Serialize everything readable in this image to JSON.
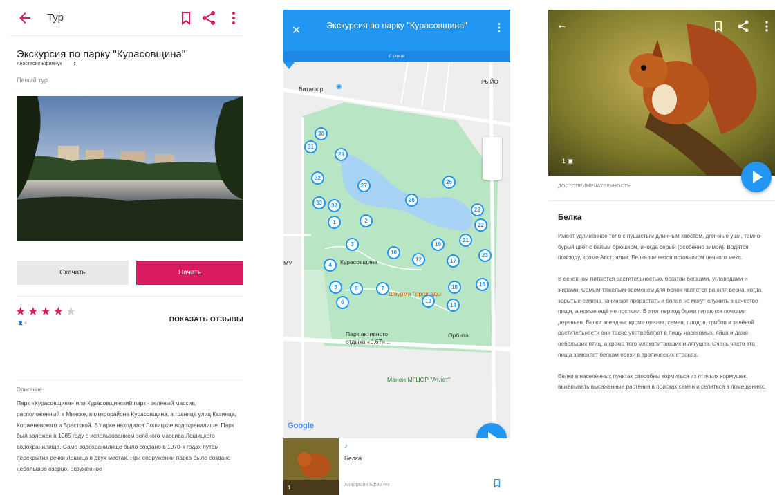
{
  "colors": {
    "accent_pink": "#d81b60",
    "accent_blue": "#2196f3",
    "water": "#a9d3f5",
    "park": "#b8e5c4"
  },
  "screen1": {
    "appbar": {
      "title": "Тур",
      "icons": [
        "arrow-back-icon",
        "bookmark-icon",
        "share-icon",
        "more-vert-icon"
      ]
    },
    "tour": {
      "title": "Экскурсия по парку \"Курасовщина\"",
      "author": "Анастасия Ефимчук",
      "type": "Пеший тур"
    },
    "buttons": {
      "download": "Скачать",
      "start": "Начать"
    },
    "rating": {
      "stars_filled": 4,
      "stars_total": 5,
      "count": "4",
      "show_reviews": "ПОКАЗАТЬ ОТЗЫВЫ"
    },
    "description": {
      "heading": "Описание",
      "text": "Парк «Курасовщина» или Курасовщинский парк - зелёный массив, расположенный в Минске, в микрорайоне Курасовщина, в границе улиц Казинца, Корженевского и Брестской. В парке находится Лошицкое водохранилище. Парк был заложен в 1985 году с использованием зелёного массива Лошицкого водохранилища. Само водохранилище было создано в 1970-х годах путём перекрытия речки Лошица в двух местах. При сооружении парка было создано небольшое озерцо, окружённое"
    }
  },
  "screen2": {
    "header": {
      "title": "Экскурсия по парку \"Курасовщина\"",
      "points": "0 очков"
    },
    "map": {
      "labels": {
        "vitalyur": "Виталюр",
        "kurasovshchina": "Курасовщина",
        "shaurma": "Шаурма Город еды",
        "park_active": "Парк активного отдыха «0,67»...",
        "orbita": "Орбита",
        "manezh": "Манеж МГЦОР \"Атлет\"",
        "my": "МУ",
        "rb": "РЬ ЙО",
        "google": "Google"
      },
      "pins": [
        "1",
        "2",
        "3",
        "4",
        "5",
        "6",
        "7",
        "9",
        "10",
        "12",
        "13",
        "14",
        "15",
        "16",
        "17",
        "19",
        "21",
        "22",
        "23",
        "24",
        "25",
        "26",
        "27",
        "28",
        "29",
        "30",
        "31",
        "32",
        "33"
      ]
    },
    "bottom": {
      "poi": "Белка",
      "author": "Анастасия Ефимчук",
      "photo_count": "1"
    }
  },
  "screen3": {
    "photo_count": "1",
    "category": "ДОСТОПРИМЕЧАТЕЛЬНОСТЬ",
    "name": "Белка",
    "paragraphs": [
      "Имеет удлинённое тело с пушистым длинным хвостом, длинные уши, тёмно-бурый цвет с белым брюшком, иногда серый (особенно зимой). Водятся повсюду, кроме Австралии. Белка является источником ценного меха.",
      "В основном питаются растительностью, богатой белками, углеводами и жирами. Самым тяжёлым временем для белок является ранняя весна, когда зарытые семена начинают прорастать и более не могут служить в качестве пищи, а новые ещё не поспели. В этот период белки питаются почками деревьев. Белки всеядны: кроме орехов, семян, плодов, грибов и зелёной растительности они также употребляют в пищу насекомых, яйца и даже небольших птиц, а кроме того млекопитающих и лягушек. Очень часто эта пища заменяет белкам орехи в тропических странах.",
      "Белки в населённых пунктах способны кормиться из птичьих кормушек, выкапывать высаженные растения в поисках семян и селиться в помещениях."
    ]
  }
}
